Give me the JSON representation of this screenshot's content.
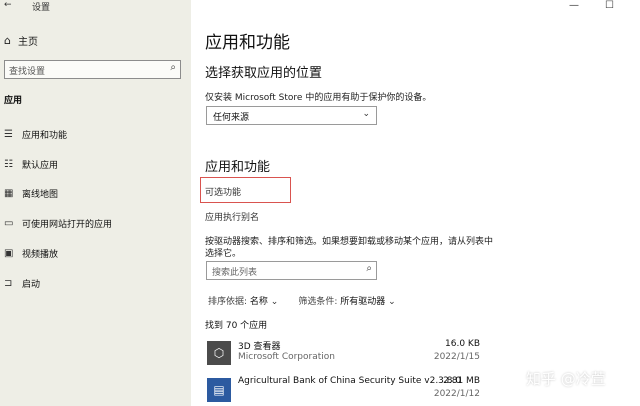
{
  "window": {
    "title": "设置",
    "back": "←",
    "minimize": "—",
    "maximize": "☐"
  },
  "sidebar": {
    "home": "主页",
    "search_placeholder": "查找设置",
    "section": "应用",
    "items": [
      {
        "label": "应用和功能",
        "icon": "list-icon"
      },
      {
        "label": "默认应用",
        "icon": "default-apps-icon"
      },
      {
        "label": "离线地图",
        "icon": "map-icon"
      },
      {
        "label": "可使用网站打开的应用",
        "icon": "web-app-icon"
      },
      {
        "label": "视频播放",
        "icon": "video-icon"
      },
      {
        "label": "启动",
        "icon": "startup-icon"
      }
    ]
  },
  "main": {
    "title": "应用和功能",
    "choose_heading": "选择获取应用的位置",
    "choose_desc": "仅安装 Microsoft Store 中的应用有助于保护你的设备。",
    "source_select": "任何来源",
    "apps_heading": "应用和功能",
    "optional_features": "可选功能",
    "app_aliases": "应用执行别名",
    "search_desc_line1": "按驱动器搜索、排序和筛选。如果想要卸载或移动某个应用，请从列表中",
    "search_desc_line2": "选择它。",
    "list_search_placeholder": "搜索此列表",
    "sort_label": "排序依据: ",
    "sort_value": "名称",
    "filter_label": "筛选条件: ",
    "filter_value": "所有驱动器",
    "found_count": "找到 70 个应用",
    "apps": [
      {
        "name": "3D 查看器",
        "publisher": "Microsoft Corporation",
        "size": "16.0 KB",
        "date": "2022/1/15"
      },
      {
        "name": "Agricultural Bank of China Security Suite v2.3.8.0",
        "publisher": "",
        "size": "2.81 MB",
        "date": "2022/1/12"
      }
    ]
  },
  "watermark": "知乎 @冷萱",
  "colors": {
    "sidebar_bg": "#eeeee6",
    "highlight_border": "#d9534f"
  }
}
